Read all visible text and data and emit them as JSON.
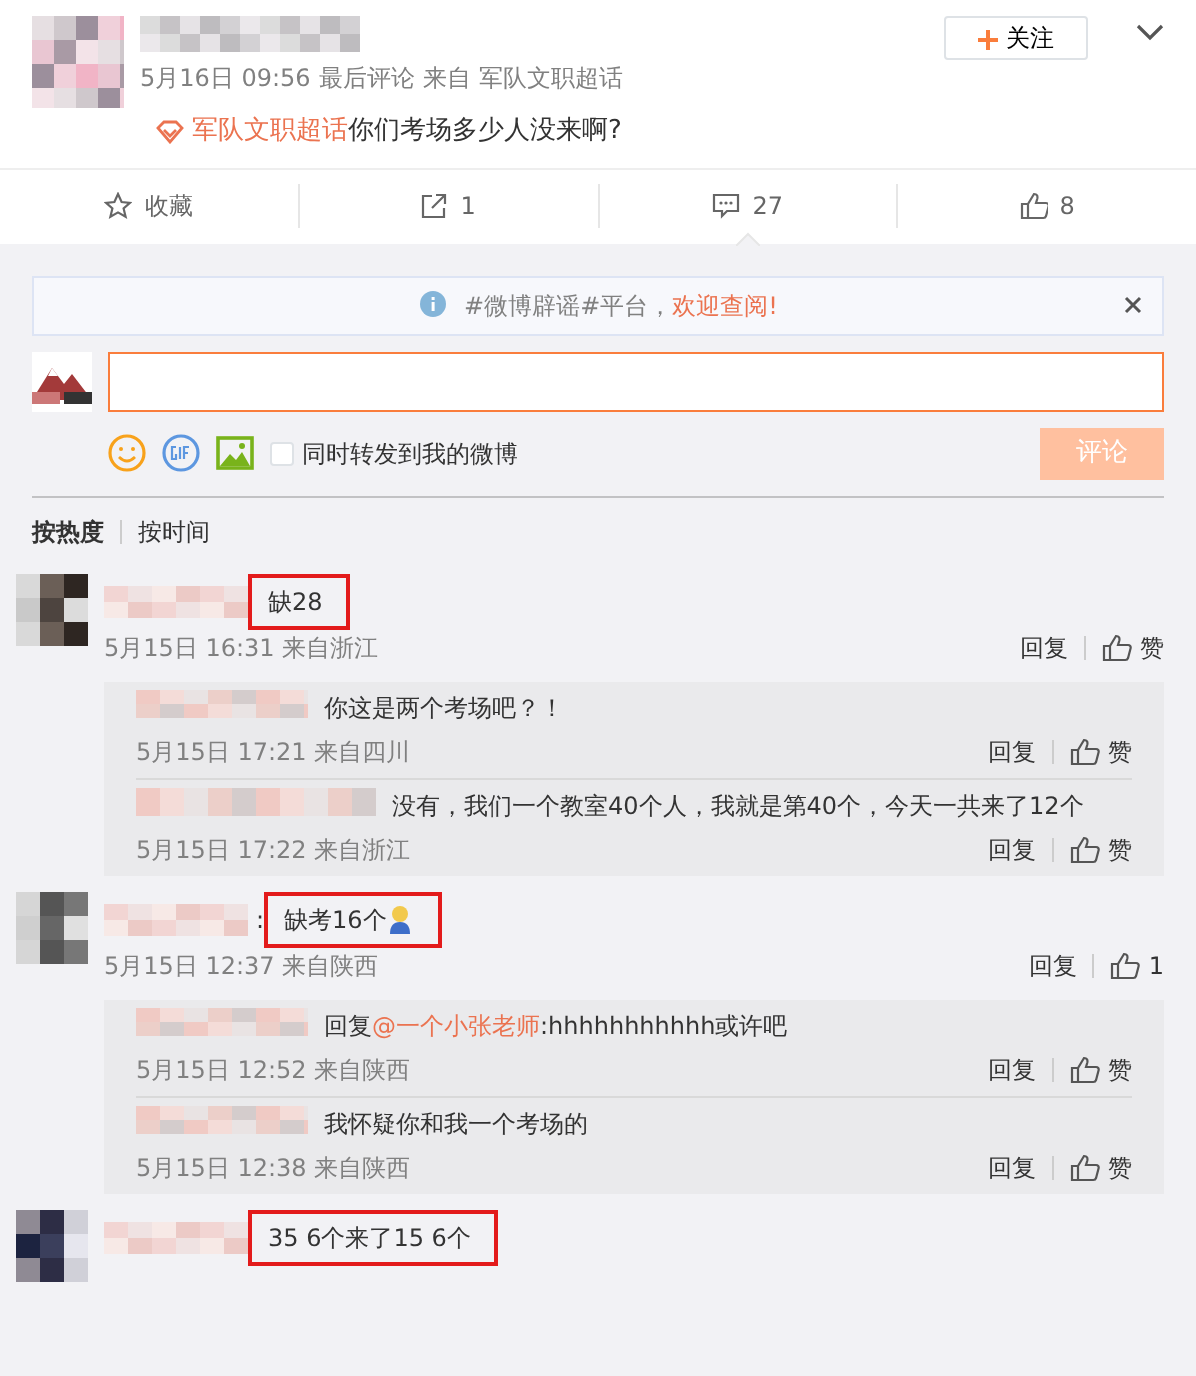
{
  "post": {
    "time": "5月16日 09:56",
    "last_comment": "最后评论",
    "source_prefix": "来自",
    "source": "军队文职超话",
    "follow": "关注",
    "topic": "军队文职超话",
    "text": "你们考场多少人没来啊?"
  },
  "actions": [
    {
      "kind": "favorite",
      "label": "收藏",
      "selected": false
    },
    {
      "kind": "repost",
      "label": "1",
      "selected": false
    },
    {
      "kind": "comment",
      "label": "27",
      "selected": true
    },
    {
      "kind": "like",
      "label": "8",
      "selected": false
    }
  ],
  "notice": {
    "text": "#微博辟谣#平台，",
    "link": "欢迎查阅!"
  },
  "composer": {
    "share_label": "同时转发到我的微博",
    "checked": false,
    "submit": "评论",
    "disabled": true
  },
  "sort": [
    {
      "label": "按热度",
      "selected": true
    },
    {
      "label": "按时间",
      "selected": false
    }
  ],
  "comments": [
    {
      "text": "缺28",
      "highlighted": true,
      "meta": "5月15日 16:31 来自浙江",
      "reply": "回复",
      "like": "赞",
      "replies": [
        {
          "text": "你这是两个考场吧？！",
          "meta": "5月15日 17:21 来自四川",
          "reply": "回复",
          "like": "赞"
        },
        {
          "text": "没有，我们一个教室40个人，我就是第40个，今天一共来了12个",
          "meta": "5月15日 17:22 来自浙江",
          "reply": "回复",
          "like": "赞"
        }
      ]
    },
    {
      "colon": ":",
      "text": "缺考16个",
      "emoji": true,
      "highlighted": true,
      "meta": "5月15日 12:37 来自陕西",
      "reply": "回复",
      "like": "1",
      "replies": [
        {
          "prefix": "回复",
          "mention": "@一个小张老师",
          "text": ":hhhhhhhhhhh或许吧",
          "meta": "5月15日 12:52 来自陕西",
          "reply": "回复",
          "like": "赞"
        },
        {
          "text": "我怀疑你和我一个考场的",
          "meta": "5月15日 12:38 来自陕西",
          "reply": "回复",
          "like": "赞"
        }
      ]
    },
    {
      "text": "35 6个来了15 6个",
      "highlighted": true
    }
  ]
}
